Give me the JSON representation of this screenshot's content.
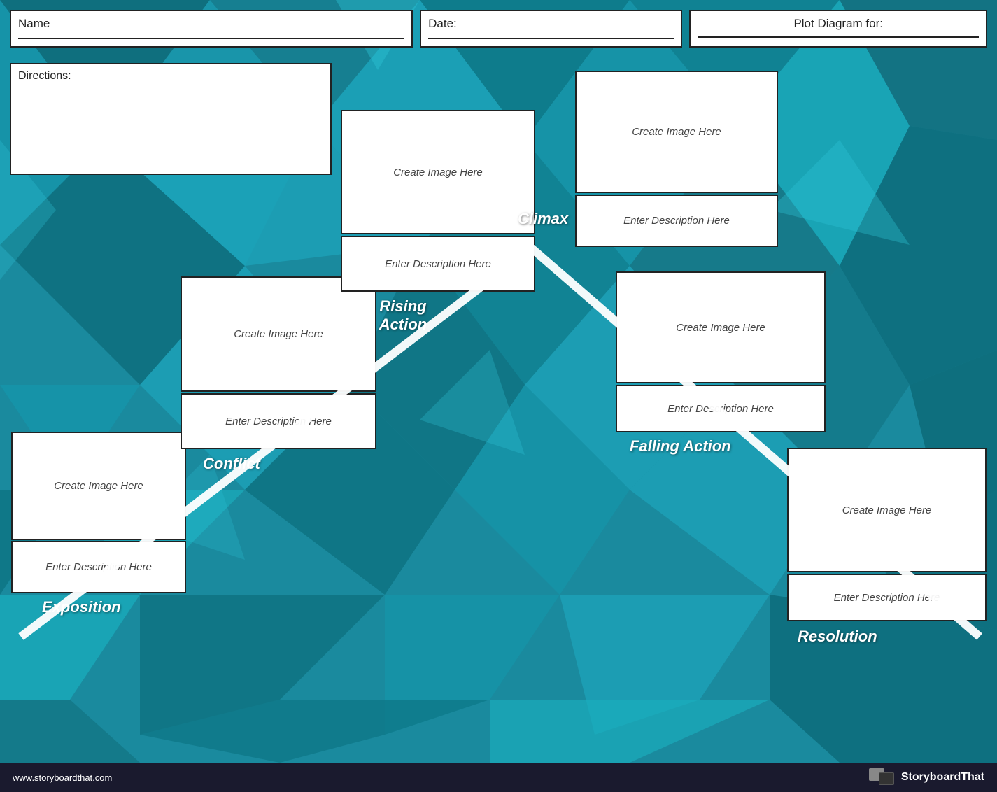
{
  "header": {
    "name_label": "Name",
    "date_label": "Date:",
    "plot_label": "Plot Diagram for:"
  },
  "directions": {
    "label": "Directions:"
  },
  "exposition": {
    "section_label": "Exposition",
    "image_placeholder": "Create Image Here",
    "desc_placeholder": "Enter Description Here"
  },
  "conflict": {
    "section_label": "Conflict",
    "image_placeholder": "Create Image Here",
    "desc_placeholder": "Enter Description Here"
  },
  "rising_action": {
    "section_label": "Rising\nAction",
    "image_placeholder": "Create Image Here",
    "desc_placeholder": "Enter Description Here"
  },
  "climax": {
    "section_label": "Climax",
    "image_placeholder": "Create Image Here",
    "desc_placeholder": "Enter Description Here"
  },
  "falling_action": {
    "section_label": "Falling Action",
    "image_placeholder": "Create Image Here",
    "desc_placeholder": "Enter Description Here"
  },
  "resolution": {
    "section_label": "Resolution",
    "image_placeholder": "Create Image Here",
    "desc_placeholder": "Enter Description Here"
  },
  "footer": {
    "url": "www.storyboardthat.com",
    "brand": "StoryboardThat"
  },
  "colors": {
    "bg_dark": "#0d6b7a",
    "bg_mid": "#1a8a9e",
    "bg_light": "#2ab5c8",
    "triangle_color": "white",
    "box_border": "#222222",
    "text_dark": "#222222",
    "text_italic": "#444444",
    "section_label_color": "white",
    "footer_bg": "#1a1a2e"
  }
}
